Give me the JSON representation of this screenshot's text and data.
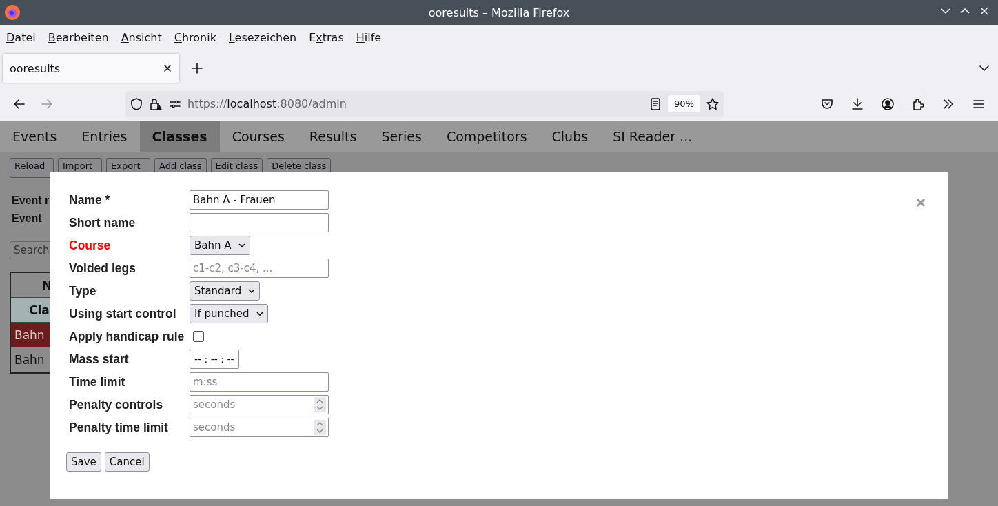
{
  "window": {
    "title": "ooresults – Mozilla Firefox"
  },
  "menubar": [
    {
      "key": "D",
      "after": "atei"
    },
    {
      "key": "B",
      "after": "earbeiten"
    },
    {
      "key": "A",
      "after": "nsicht"
    },
    {
      "key": "C",
      "after": "hronik"
    },
    {
      "key": "L",
      "after": "esezeichen"
    },
    {
      "before": "E",
      "key": "x",
      "after": "tras"
    },
    {
      "key": "H",
      "after": "ilfe"
    }
  ],
  "browser_tabs": [
    {
      "label": "ooresults",
      "selected": true
    }
  ],
  "address_bar": {
    "scheme": "https://",
    "host": "localhost",
    "rest": ":8080/admin",
    "zoom": "90%"
  },
  "app_nav": [
    {
      "label": "Events",
      "selected": false
    },
    {
      "label": "Entries",
      "selected": false
    },
    {
      "label": "Classes",
      "selected": true
    },
    {
      "label": "Courses",
      "selected": false
    },
    {
      "label": "Results",
      "selected": false
    },
    {
      "label": "Series",
      "selected": false
    },
    {
      "label": "Competitors",
      "selected": false
    },
    {
      "label": "Clubs",
      "selected": false
    },
    {
      "label": "SI Reader ...",
      "selected": false
    }
  ],
  "toolbar": [
    "Reload",
    "Import",
    "Export",
    "Add class",
    "Edit class",
    "Delete class"
  ],
  "event_info": [
    "Event r",
    "Event"
  ],
  "search": {
    "placeholder": "Search"
  },
  "table": {
    "header": "N",
    "group": "Cla",
    "rows": [
      {
        "text": "Bahn",
        "selected": true
      },
      {
        "text": "Bahn",
        "selected": false
      }
    ]
  },
  "dialog": {
    "fields": [
      {
        "kind": "text",
        "label": "Name *",
        "error": false,
        "value": "Bahn A - Frauen"
      },
      {
        "kind": "text",
        "label": "Short name",
        "error": false
      },
      {
        "kind": "select",
        "label": "Course",
        "error": true,
        "value": "Bahn A"
      },
      {
        "kind": "text",
        "label": "Voided legs",
        "error": false,
        "placeholder": "c1-c2, c3-c4, ..."
      },
      {
        "kind": "select",
        "label": "Type",
        "error": false,
        "value": "Standard"
      },
      {
        "kind": "select",
        "label": "Using start control",
        "error": false,
        "value": "If punched"
      },
      {
        "kind": "checkbox",
        "label": "Apply handicap rule",
        "error": false,
        "checked": false
      },
      {
        "kind": "time",
        "label": "Mass start",
        "error": false,
        "value": "-- : -- : --"
      },
      {
        "kind": "text",
        "label": "Time limit",
        "error": false,
        "placeholder": "m:ss"
      },
      {
        "kind": "number",
        "label": "Penalty controls",
        "error": false,
        "placeholder": "seconds"
      },
      {
        "kind": "number",
        "label": "Penalty time limit",
        "error": false,
        "placeholder": "seconds"
      }
    ],
    "buttons": [
      "Save",
      "Cancel"
    ]
  }
}
